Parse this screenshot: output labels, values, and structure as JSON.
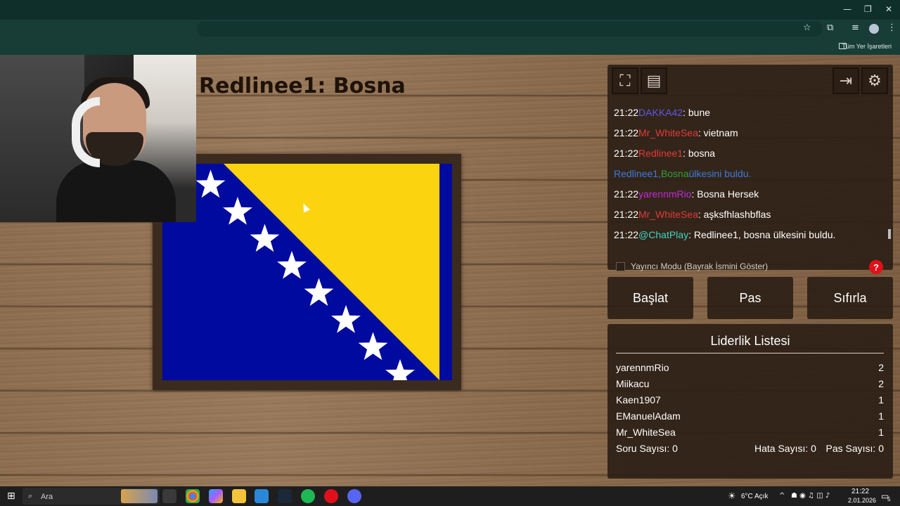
{
  "browser": {
    "bookmarks_label": "Tüm Yer İşaretleri",
    "window_controls": [
      "—",
      "❐",
      "✕"
    ]
  },
  "game": {
    "title": "Redlinee1: Bosna"
  },
  "chat": {
    "messages": [
      {
        "time": "21:22",
        "user": "DAKKA42",
        "user_color": "#5a5ae6",
        "text": ": bune"
      },
      {
        "time": "21:22",
        "user": "Mr_WhiteSea",
        "user_color": "#e23a3a",
        "text": ": vietnam"
      },
      {
        "time": "21:22",
        "user": "Redlinee1",
        "user_color": "#e23a3a",
        "text": ": bosna"
      },
      {
        "system": true,
        "user": "Redlinee1,",
        "user_color": "#3b7bdb",
        "country": "Bosna",
        "country_color": "#2e9e3a",
        "text": "ülkesini buldu.",
        "text_color": "#3b7bdb"
      },
      {
        "time": "21:22",
        "user": "yarennmRio",
        "user_color": "#c02ad6",
        "text": ": Bosna Hersek"
      },
      {
        "time": "21:22",
        "user": "Mr_WhiteSea",
        "user_color": "#e23a3a",
        "text": ": aşksfhlashbflas"
      },
      {
        "time": "21:22",
        "user": "@ChatPlay",
        "user_color": "#3fd6c6",
        "text": ": Redlinee1, bosna ülkesini buldu."
      }
    ],
    "streamer_mode_label": "Yayıncı Modu (Bayrak İsmini Göster)",
    "help_label": "?"
  },
  "actions": {
    "start": "Başlat",
    "pass": "Pas",
    "reset": "Sıfırla"
  },
  "leaderboard": {
    "title": "Liderlik Listesi",
    "rows": [
      {
        "name": "yarennmRio",
        "score": "2"
      },
      {
        "name": "Miikacu",
        "score": "2"
      },
      {
        "name": "Kaen1907",
        "score": "1"
      },
      {
        "name": "EManuelAdam",
        "score": "1"
      },
      {
        "name": "Mr_WhiteSea",
        "score": "1"
      }
    ],
    "question_count": "Soru Sayısı: 0",
    "error_count": "Hata Sayısı: 0",
    "pass_count": "Pas Sayısı: 0"
  },
  "taskbar": {
    "search_placeholder": "Ara",
    "weather": "6°C  Açık",
    "time": "21:22",
    "date": "2.01.2026",
    "notification_count": "5"
  },
  "colors": {
    "flag_blue": "#000a9e",
    "flag_yellow": "#fcd30f",
    "panel_bg": "#2d2016"
  }
}
